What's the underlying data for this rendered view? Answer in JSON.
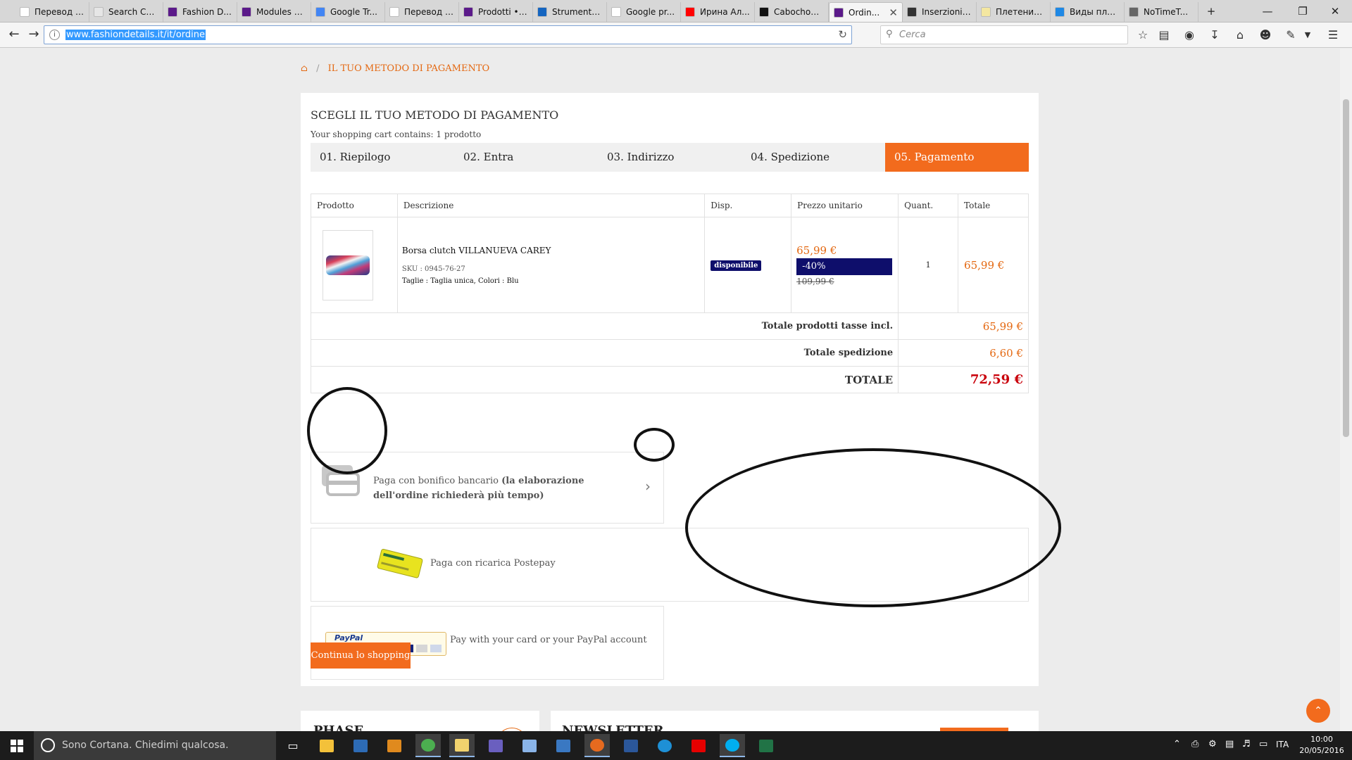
{
  "browser": {
    "tabs": [
      {
        "label": "Перевод с...",
        "color": "#ffffff"
      },
      {
        "label": "Search Co...",
        "color": "#e6e6e6"
      },
      {
        "label": "Fashion D...",
        "color": "#5b1a8a"
      },
      {
        "label": "Modules •...",
        "color": "#5b1a8a"
      },
      {
        "label": "Google Tr...",
        "color": "#4285f4"
      },
      {
        "label": "Перевод с...",
        "color": "#ffffff"
      },
      {
        "label": "Prodotti • ...",
        "color": "#5b1a8a"
      },
      {
        "label": "Strumento...",
        "color": "#1565c0"
      },
      {
        "label": "Google pr...",
        "color": "#ffffff"
      },
      {
        "label": "Ирина Ал...",
        "color": "#ff0000"
      },
      {
        "label": "Cabochon...",
        "color": "#111111"
      },
      {
        "label": "Ordin...",
        "color": "#5b1a8a",
        "active": true
      },
      {
        "label": "Inserzioni i...",
        "color": "#333333"
      },
      {
        "label": "Плетение ...",
        "color": "#f4e7a1"
      },
      {
        "label": "Виды пле...",
        "color": "#1e88e5"
      },
      {
        "label": "NoTimeT...",
        "color": "#666666"
      }
    ],
    "new_tab": "+",
    "url": "www.fashiondetails.it/it/ordine",
    "search_placeholder": "Cerca"
  },
  "breadcrumb": {
    "home_icon": "home-icon",
    "separator": "/",
    "current": "IL TUO METODO DI PAGAMENTO"
  },
  "checkout": {
    "heading": "SCEGLI IL TUO METODO DI PAGAMENTO",
    "cart_count": "Your shopping cart contains: 1 prodotto",
    "steps": [
      "01. Riepilogo",
      "02. Entra",
      "03. Indirizzo",
      "04. Spedizione",
      "05. Pagamento"
    ],
    "current_step": 5
  },
  "cart": {
    "headers": [
      "Prodotto",
      "Descrizione",
      "Disp.",
      "Prezzo unitario",
      "Quant.",
      "Totale"
    ],
    "item": {
      "name": "Borsa clutch VILLANUEVA CAREY",
      "sku": "SKU : 0945-76-27",
      "attributes": "Taglie : Taglia unica, Colori : Blu",
      "availability": "disponibile",
      "price": "65,99 €",
      "discount": "-40%",
      "old_price": "109,99 €",
      "quantity": "1",
      "total": "65,99 €"
    },
    "summary": {
      "products_label": "Totale prodotti tasse incl.",
      "products_value": "65,99 €",
      "shipping_label": "Totale spedizione",
      "shipping_value": "6,60 €",
      "total_label": "TOTALE",
      "total_value": "72,59 €"
    }
  },
  "payment": {
    "bank_text": "Paga con bonifico bancario",
    "bank_note": "(la elaborazione dell'ordine richiederà più tempo)",
    "postepay_text": "Paga con ricarica Postepay",
    "paypal_text": "Pay with your card or your PayPal account",
    "paypal_logo_text": "PayPal"
  },
  "continue_button": "Continua lo shopping",
  "footer": {
    "left_title": "PHASE",
    "right_title": "NEWSLETTER"
  },
  "taskbar": {
    "cortana_placeholder": "Sono Cortana. Chiedimi qualcosa.",
    "language": "ITA",
    "time": "10:00",
    "date": "20/05/2016"
  },
  "colors": {
    "accent": "#f26b1d",
    "price": "#e46811",
    "badge": "#0e0e6b",
    "grand_total": "#c9000a"
  }
}
